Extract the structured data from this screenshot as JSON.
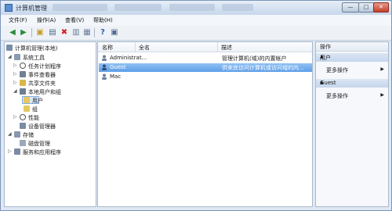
{
  "window": {
    "title": "计算机管理",
    "controls": {
      "minimize": "—",
      "maximize": "□",
      "close": "✕"
    }
  },
  "menu": [
    "文件(F)",
    "操作(A)",
    "查看(V)",
    "帮助(H)"
  ],
  "toolbar": [
    "back-icon",
    "forward-icon",
    "up-icon",
    "show-hide-tree-icon",
    "delete-icon",
    "properties-icon",
    "export-icon",
    "help-icon",
    "console-icon"
  ],
  "tree": {
    "root": "计算机管理(本地)",
    "system_tools": "系统工具",
    "task_scheduler": "任务计划程序",
    "event_viewer": "事件查看器",
    "shared_folders": "共享文件夹",
    "local_users": "本地用户和组",
    "users": "用户",
    "groups": "组",
    "performance": "性能",
    "device_manager": "设备管理器",
    "storage": "存储",
    "disk_management": "磁盘管理",
    "services_apps": "服务和应用程序"
  },
  "list": {
    "columns": {
      "name": "名称",
      "fullname": "全名",
      "description": "描述"
    },
    "rows": [
      {
        "name": "Administrat...",
        "fullname": "",
        "description": "管理计算机(域)的内置帐户",
        "selected": false
      },
      {
        "name": "Guest",
        "fullname": "",
        "description": "供来宾访问计算机或访问域的内...",
        "selected": true
      },
      {
        "name": "Mac",
        "fullname": "",
        "description": "",
        "selected": false
      }
    ]
  },
  "actions": {
    "header": "操作",
    "section1": "用户",
    "more1": "更多操作",
    "section2": "Guest",
    "more2": "更多操作"
  },
  "colors": {
    "selection": "#5e9ee8",
    "titlebar": "#c8d7ea",
    "close": "#c4402b"
  }
}
